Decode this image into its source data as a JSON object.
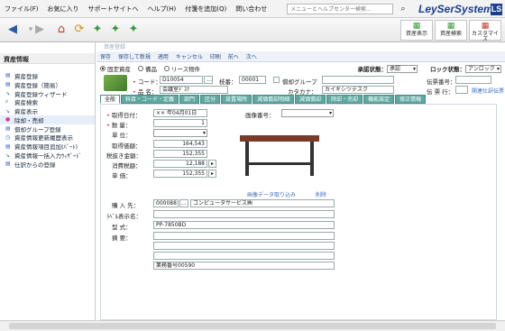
{
  "menu": [
    "ファイル(F)",
    "お気に入り",
    "サポートサイトへ",
    "ヘルプ(H)",
    "付箋を追加(Q)",
    "問い合わせ"
  ],
  "search": {
    "placeholder": "メニューとヘルプセンター検索..."
  },
  "brand": {
    "name": "LeySerSystem",
    "badge": "LS",
    "color": "#1b3f8c"
  },
  "ribbon": [
    {
      "label": "資産表示",
      "icon": "asset-view-icon"
    },
    {
      "label": "資産検索",
      "icon": "asset-search-icon"
    },
    {
      "label": "カスタマイズ",
      "icon": "customize-icon"
    }
  ],
  "sidebar": {
    "title": "資産情報",
    "items": [
      "資産登録",
      "資産登録（簡易）",
      "資産登録ウィザード",
      "資産検索",
      "資産表示",
      "除却・売却",
      "償却グループ登録",
      "資産情報更新履歴表示",
      "資産情報項目追加(ﾊﾞｰﾄ)",
      "資産情報一括入力ｳｨｻﾞｰﾄﾞ",
      "仕訳からの登録"
    ]
  },
  "breadcrumb": "資産登録",
  "toolbar": [
    "保存",
    "保存して新規",
    "適用",
    "キャンセル",
    "印刷",
    "前へ",
    "次へ"
  ],
  "header": {
    "types": [
      "固定資産",
      "備品",
      "リース物件"
    ],
    "approval_label": "承認状態：",
    "approval_value": "承認",
    "lock_label": "ロック状態：",
    "lock_value": "アンロック"
  },
  "ident": {
    "code_label": "コード：",
    "code_value": "D10054",
    "branch_label": "枝番：",
    "branch_value": "00001",
    "group_label": "償却グループ",
    "slip_label": "伝票番号：",
    "name_label": "品 名：",
    "name_value": "会議室ﾃﾞｽｸ",
    "kana_label": "カタカナ：",
    "kana_value": "カイギシツデスク",
    "slip2_label": "伝 票 行：",
    "related_link": "関連仕訳伝票"
  },
  "tabs": [
    "全般",
    "科目・コード・定義",
    "部門",
    "区分",
    "設置場所",
    "減価償却明細",
    "減価償却",
    "除却・売却",
    "機能設定",
    "修正情報"
  ],
  "fields": {
    "acq_date_label": "取得日付：",
    "acq_date_value": "×× 年04月01日",
    "image_no_label": "画像番号：",
    "qty_label": "数 量：",
    "qty_value": "1",
    "unit_label": "単 位：",
    "cost_label": "取得価額：",
    "cost_value": "164,543",
    "net_label": "税抜き金額：",
    "net_value": "152,355",
    "tax_label": "消費税額：",
    "tax_value": "12,188",
    "price_label": "単 価：",
    "price_value": "152,355",
    "image_link": "画像データ取り込み",
    "delete_link": "削除",
    "vendor_label": "購 入 先：",
    "vendor_code": "000088",
    "vendor_name": "コンピュータサービス㈱",
    "label_name_label": "ﾗﾍﾞﾙ表示名：",
    "model_label": "型 式：",
    "model_value": "PP-7850BD",
    "note_label": "摘 要：",
    "note_value": "業務番号00590"
  }
}
